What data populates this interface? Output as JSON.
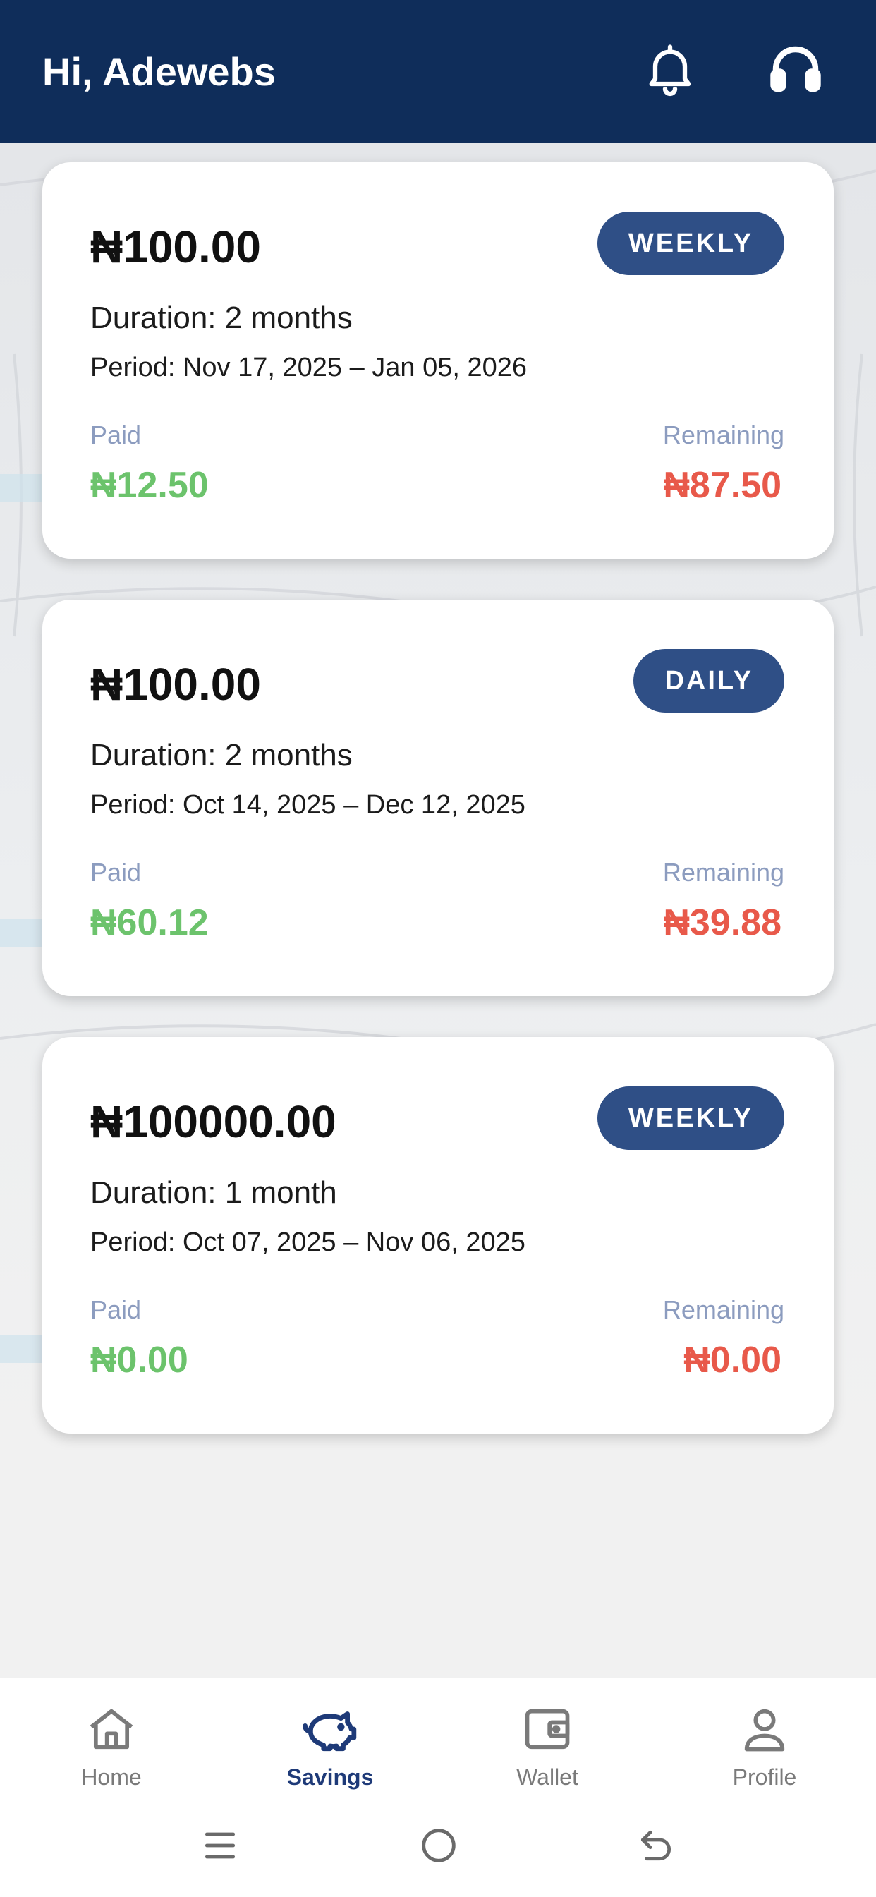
{
  "header": {
    "greeting": "Hi, Adewebs",
    "icons": [
      "bell-icon",
      "headset-icon"
    ]
  },
  "cards": [
    {
      "amount": "₦100.00",
      "frequency": "WEEKLY",
      "duration": "Duration: 2 months",
      "period": "Period: Nov 17, 2025 – Jan 05, 2026",
      "paid_label": "Paid",
      "paid_value": "₦12.50",
      "remaining_label": "Remaining",
      "remaining_value": "₦87.50"
    },
    {
      "amount": "₦100.00",
      "frequency": "DAILY",
      "duration": "Duration: 2 months",
      "period": "Period: Oct 14, 2025 – Dec 12, 2025",
      "paid_label": "Paid",
      "paid_value": "₦60.12",
      "remaining_label": "Remaining",
      "remaining_value": "₦39.88"
    },
    {
      "amount": "₦100000.00",
      "frequency": "WEEKLY",
      "duration": "Duration: 1 month",
      "period": "Period: Oct 07, 2025 – Nov 06, 2025",
      "paid_label": "Paid",
      "paid_value": "₦0.00",
      "remaining_label": "Remaining",
      "remaining_value": "₦0.00"
    }
  ],
  "nav": {
    "home": "Home",
    "savings": "Savings",
    "wallet": "Wallet",
    "profile": "Profile",
    "active": "savings"
  },
  "colors": {
    "header_bg": "#0f2d5a",
    "badge_bg": "#2f4f86",
    "paid": "#6cc36c",
    "remaining": "#e8594a",
    "nav_active": "#1e3a78"
  }
}
